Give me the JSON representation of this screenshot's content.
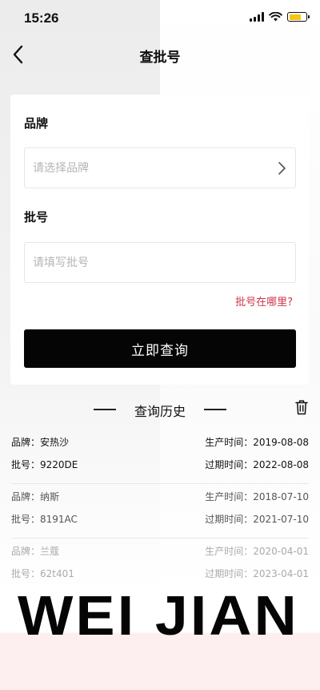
{
  "status_bar": {
    "time": "15:26"
  },
  "header": {
    "title": "查批号"
  },
  "form": {
    "brand_label": "品牌",
    "brand_placeholder": "请选择品牌",
    "batch_label": "批号",
    "batch_placeholder": "请填写批号",
    "where_link": "批号在哪里?",
    "submit_label": "立即查询"
  },
  "history": {
    "title": "查询历史",
    "items": [
      {
        "brand_label": "品牌：",
        "brand": "安热沙",
        "produce_label": "生产时间：",
        "produce": "2019-08-08",
        "batch_label": "批号：",
        "batch": "9220DE",
        "expire_label": "过期时间：",
        "expire": "2022-08-08"
      },
      {
        "brand_label": "品牌：",
        "brand": "纳斯",
        "produce_label": "生产时间：",
        "produce": "2018-07-10",
        "batch_label": "批号：",
        "batch": "8191AC",
        "expire_label": "过期时间：",
        "expire": "2021-07-10"
      },
      {
        "brand_label": "品牌：",
        "brand": "兰蔻",
        "produce_label": "生产时间：",
        "produce": "2020-04-01",
        "batch_label": "批号：",
        "batch": "62t401",
        "expire_label": "过期时间：",
        "expire": "2023-04-01"
      }
    ]
  },
  "footer": {
    "wordmark": "WEI JIAN"
  },
  "colors": {
    "accent_red": "#d0344a",
    "button_black": "#050505",
    "battery_yellow": "#f5c518"
  }
}
